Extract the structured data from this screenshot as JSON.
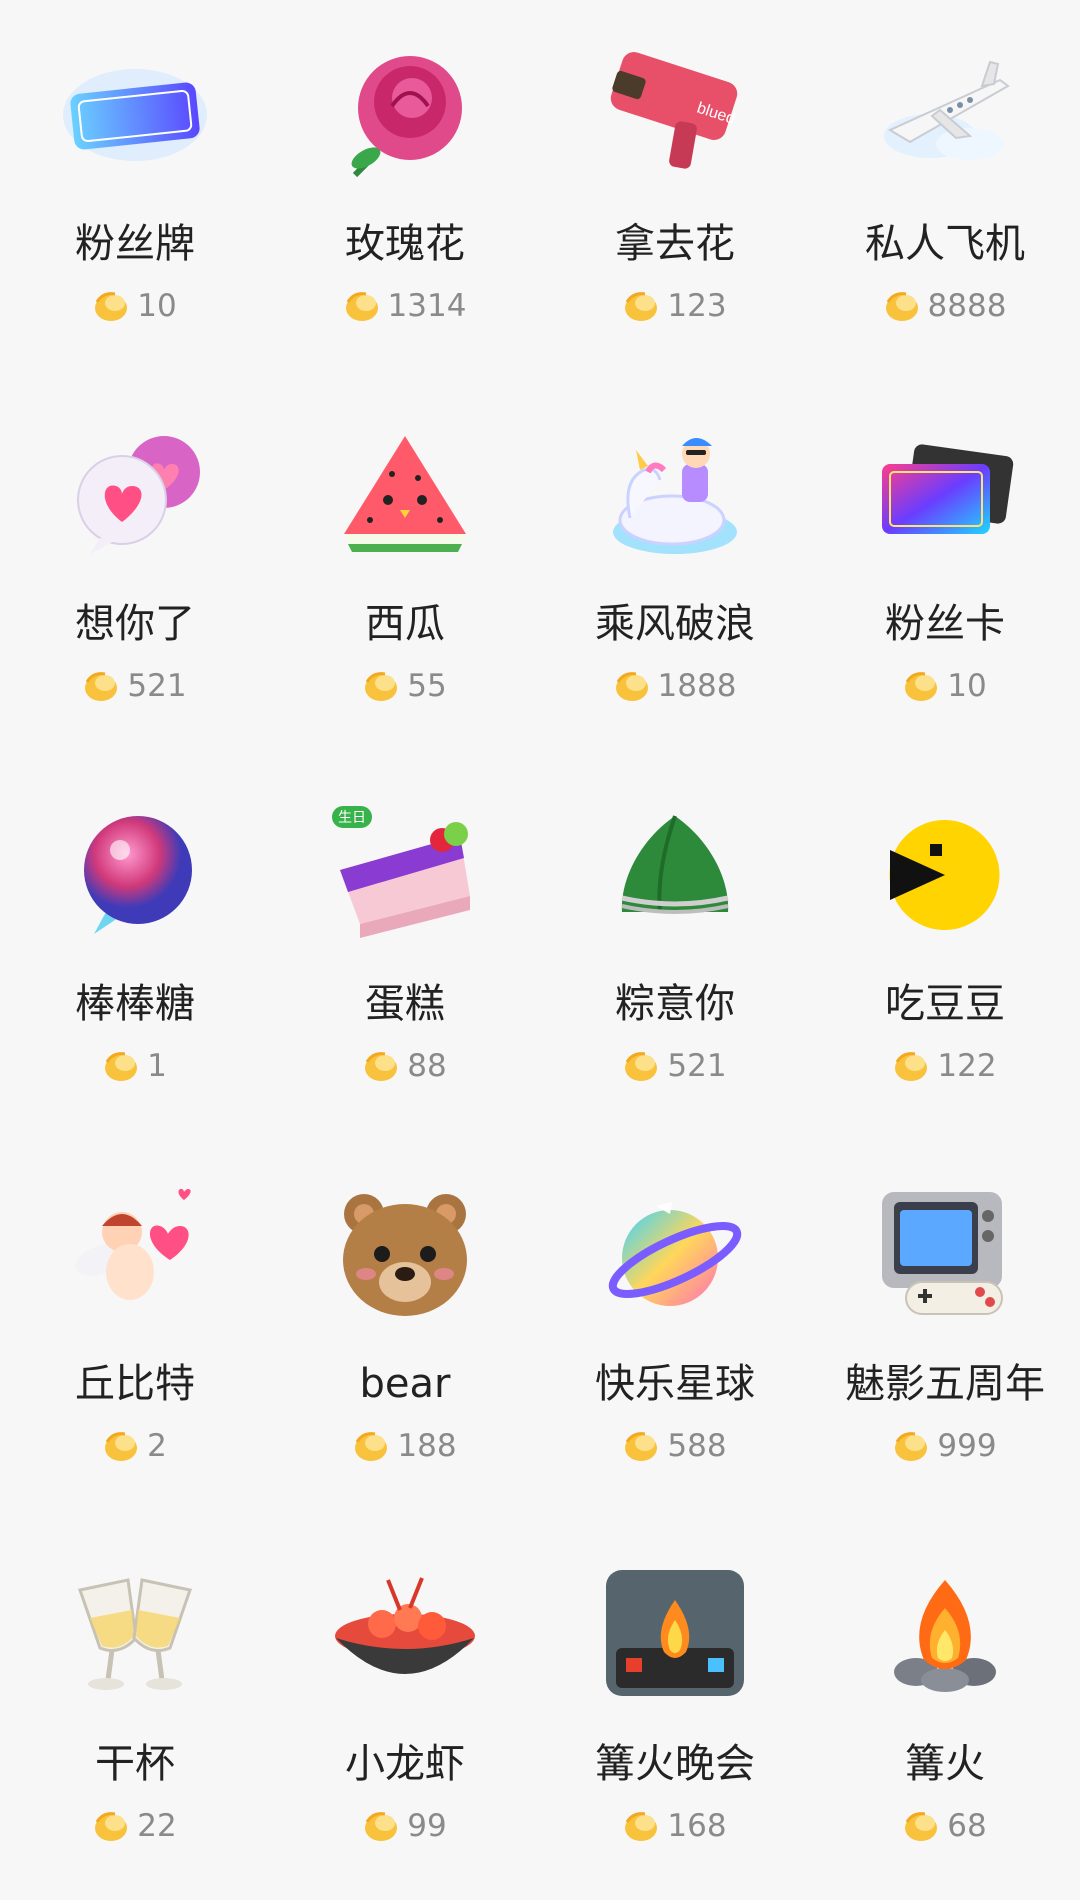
{
  "coin_icon": "coin-icon",
  "gifts": [
    {
      "name": "粉丝牌",
      "price": "10",
      "icon": "fan-badge-icon"
    },
    {
      "name": "玫瑰花",
      "price": "1314",
      "icon": "rose-icon"
    },
    {
      "name": "拿去花",
      "price": "123",
      "icon": "money-gun-icon",
      "icon_text": "blued"
    },
    {
      "name": "私人飞机",
      "price": "8888",
      "icon": "private-jet-icon"
    },
    {
      "name": "想你了",
      "price": "521",
      "icon": "heart-bubbles-icon"
    },
    {
      "name": "西瓜",
      "price": "55",
      "icon": "watermelon-icon"
    },
    {
      "name": "乘风破浪",
      "price": "1888",
      "icon": "unicorn-float-icon"
    },
    {
      "name": "粉丝卡",
      "price": "10",
      "icon": "fan-card-icon"
    },
    {
      "name": "棒棒糖",
      "price": "1",
      "icon": "lollipop-icon"
    },
    {
      "name": "蛋糕",
      "price": "88",
      "icon": "cake-icon",
      "badge": "生日"
    },
    {
      "name": "粽意你",
      "price": "521",
      "icon": "zongzi-icon"
    },
    {
      "name": "吃豆豆",
      "price": "122",
      "icon": "pacman-icon"
    },
    {
      "name": "丘比特",
      "price": "2",
      "icon": "cupid-icon"
    },
    {
      "name": "bear",
      "price": "188",
      "icon": "bear-icon"
    },
    {
      "name": "快乐星球",
      "price": "588",
      "icon": "planet-icon"
    },
    {
      "name": "魅影五周年",
      "price": "999",
      "icon": "retro-tv-controller-icon"
    },
    {
      "name": "干杯",
      "price": "22",
      "icon": "champagne-glasses-icon"
    },
    {
      "name": "小龙虾",
      "price": "99",
      "icon": "crayfish-bowl-icon"
    },
    {
      "name": "篝火晚会",
      "price": "168",
      "icon": "bonfire-party-icon"
    },
    {
      "name": "篝火",
      "price": "68",
      "icon": "campfire-icon"
    }
  ]
}
